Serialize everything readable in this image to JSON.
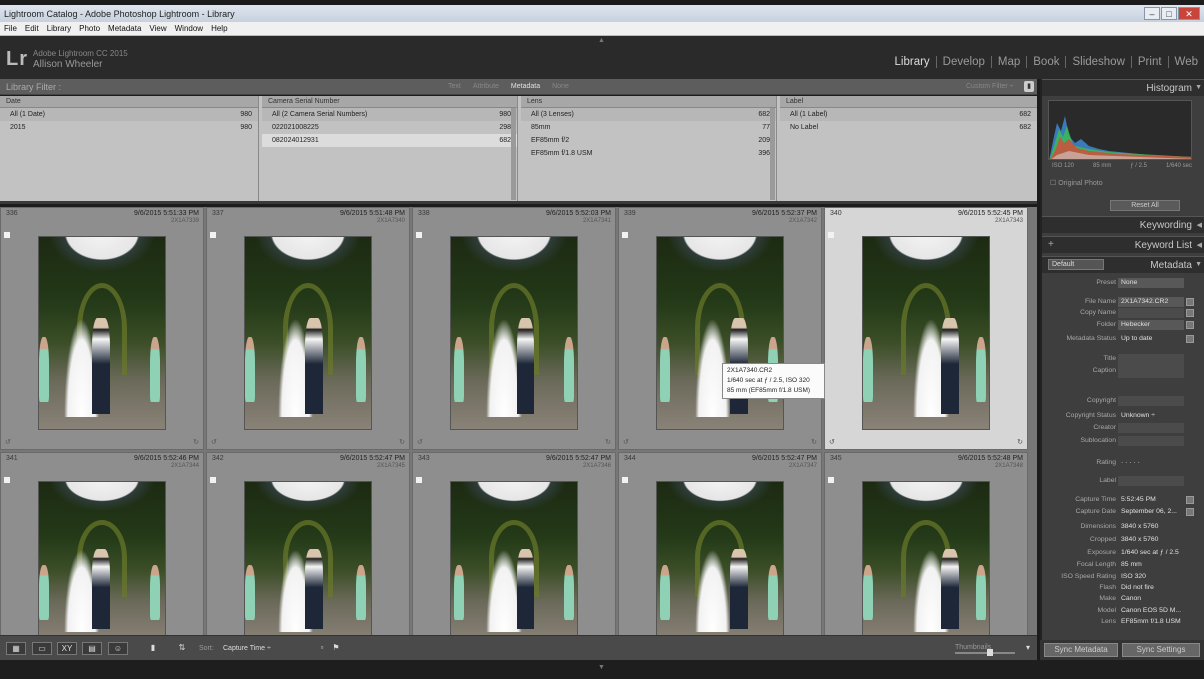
{
  "window": {
    "title": "Lightroom Catalog - Adobe Photoshop Lightroom - Library",
    "min": "–",
    "max": "□",
    "close": "✕"
  },
  "menu": [
    "File",
    "Edit",
    "Library",
    "Photo",
    "Metadata",
    "View",
    "Window",
    "Help"
  ],
  "header": {
    "logo": "Lr",
    "product": "Adobe Lightroom CC 2015",
    "user": "Allison Wheeler",
    "modules": [
      "Library",
      "Develop",
      "Map",
      "Book",
      "Slideshow",
      "Print",
      "Web"
    ],
    "active_module": "Library"
  },
  "library_filter": {
    "label": "Library Filter :",
    "tabs": [
      "Text",
      "Attribute",
      "Metadata",
      "None"
    ],
    "active_tab": "Metadata",
    "custom_filter": "Custom Filter ÷"
  },
  "metadata_columns": [
    {
      "header": "Date",
      "rows": [
        {
          "label": "All (1 Date)",
          "count": "980"
        },
        {
          "label": "2015",
          "count": "980"
        }
      ]
    },
    {
      "header": "Camera Serial Number",
      "rows": [
        {
          "label": "All (2 Camera Serial Numbers)",
          "count": "980"
        },
        {
          "label": "022021008225",
          "count": "298"
        },
        {
          "label": "082024012931",
          "count": "682"
        }
      ]
    },
    {
      "header": "Lens",
      "rows": [
        {
          "label": "All (3 Lenses)",
          "count": "682"
        },
        {
          "label": "85mm",
          "count": "77"
        },
        {
          "label": "EF85mm f/2",
          "count": "209"
        },
        {
          "label": "EF85mm f/1.8 USM",
          "count": "396"
        }
      ]
    },
    {
      "header": "Label",
      "rows": [
        {
          "label": "All (1 Label)",
          "count": "682"
        },
        {
          "label": "No Label",
          "count": "682"
        }
      ]
    }
  ],
  "grid": [
    {
      "num": "336",
      "date": "9/6/2015 5:51:33 PM",
      "file": "2X1A7339"
    },
    {
      "num": "337",
      "date": "9/6/2015 5:51:48 PM",
      "file": "2X1A7340"
    },
    {
      "num": "338",
      "date": "9/6/2015 5:52:03 PM",
      "file": "2X1A7341"
    },
    {
      "num": "339",
      "date": "9/6/2015 5:52:37 PM",
      "file": "2X1A7342"
    },
    {
      "num": "340",
      "date": "9/6/2015 5:52:45 PM",
      "file": "2X1A7343"
    },
    {
      "num": "341",
      "date": "9/6/2015 5:52:46 PM",
      "file": "2X1A7344"
    },
    {
      "num": "342",
      "date": "9/6/2015 5:52:47 PM",
      "file": "2X1A7345"
    },
    {
      "num": "343",
      "date": "9/6/2015 5:52:47 PM",
      "file": "2X1A7346"
    },
    {
      "num": "344",
      "date": "9/6/2015 5:52:47 PM",
      "file": "2X1A7347"
    },
    {
      "num": "345",
      "date": "9/6/2015 5:52:48 PM",
      "file": "2X1A7348"
    }
  ],
  "tooltip": {
    "line1": "2X1A7340.CR2",
    "line2": "1/640 sec at ƒ / 2.5, ISO 320",
    "line3": "85 mm (EF85mm f/1.8 USM)"
  },
  "toolbar": {
    "sort_label": "Sort:",
    "sort_value": "Capture Time ÷",
    "thumbnails_label": "Thumbnails"
  },
  "right_panel": {
    "histogram_title": "Histogram",
    "histogram_info": [
      "ISO 120",
      "85 mm",
      "ƒ / 2.5",
      "1/640 sec"
    ],
    "original_photo": "Original Photo",
    "reset_all": "Reset All",
    "keywording": "Keywording",
    "keyword_list": "Keyword List",
    "metadata": "Metadata",
    "preset_select": "Default",
    "fields": [
      {
        "k": "Preset",
        "v": "None"
      },
      {
        "k": "File Name",
        "v": "2X1A7342.CR2"
      },
      {
        "k": "Copy Name",
        "v": ""
      },
      {
        "k": "Folder",
        "v": "Hebecker"
      },
      {
        "k": "Metadata Status",
        "v": "Up to date"
      },
      {
        "k": "Title",
        "v": ""
      },
      {
        "k": "Caption",
        "v": ""
      },
      {
        "k": "Copyright",
        "v": ""
      },
      {
        "k": "Copyright Status",
        "v": "Unknown ÷"
      },
      {
        "k": "Creator",
        "v": ""
      },
      {
        "k": "Sublocation",
        "v": ""
      },
      {
        "k": "Rating",
        "v": "· · · · ·"
      },
      {
        "k": "Label",
        "v": ""
      },
      {
        "k": "Capture Time",
        "v": "5:52:45 PM"
      },
      {
        "k": "Capture Date",
        "v": "September 06, 2..."
      },
      {
        "k": "Dimensions",
        "v": "3840 x 5760"
      },
      {
        "k": "Cropped",
        "v": "3840 x 5760"
      },
      {
        "k": "Exposure",
        "v": "1/640 sec at ƒ / 2.5"
      },
      {
        "k": "Focal Length",
        "v": "85 mm"
      },
      {
        "k": "ISO Speed Rating",
        "v": "ISO 320"
      },
      {
        "k": "Flash",
        "v": "Did not fire"
      },
      {
        "k": "Make",
        "v": "Canon"
      },
      {
        "k": "Model",
        "v": "Canon EOS 5D M..."
      },
      {
        "k": "Lens",
        "v": "EF85mm f/1.8 USM"
      }
    ],
    "sync_metadata": "Sync Metadata",
    "sync_settings": "Sync Settings"
  }
}
